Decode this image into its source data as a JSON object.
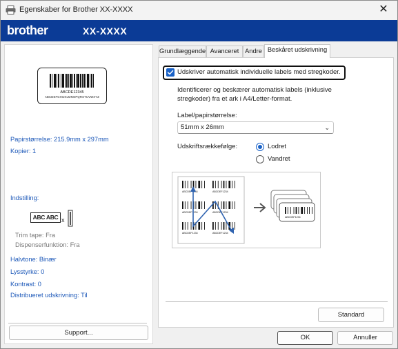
{
  "window": {
    "title": "Egenskaber for Brother XX-XXXX",
    "close_label": "✕"
  },
  "brand": {
    "logo": "brother",
    "model": "XX-XXXX",
    "bar_color": "#0b3b96"
  },
  "left": {
    "preview_text_1": "ABCDE12345",
    "preview_text_2": "ABCDEFGHIJKLMNOPQRSTUVWXYZ",
    "paper_size": "Papirstørrelse: 215.9mm x 297mm",
    "copies": "Kopier: 1",
    "setting_header": "Indstilling:",
    "setting_icon_text": "ABC ABC",
    "trim_tape": "Trim tape: Fra",
    "dispenser": "Dispenserfunktion: Fra",
    "halftone": "Halvtone: Binær",
    "brightness": "Lysstyrke:   0",
    "contrast": "Kontrast:   0",
    "distributed": "Distribueret udskrivning: Til",
    "support_button": "Support..."
  },
  "tabs": [
    {
      "label": "Grundlæggende",
      "active": false
    },
    {
      "label": "Avanceret",
      "active": false
    },
    {
      "label": "Andre",
      "active": false
    },
    {
      "label": "Beskåret udskrivning",
      "active": true
    }
  ],
  "crop": {
    "checkbox_label": "Udskriver automatisk individuelle labels med stregkoder.",
    "checkbox_checked": true,
    "desc_line_1": "Identificerer og beskærer automatisk labels (inklusive",
    "desc_line_2": "stregkoder) fra et ark i A4/Letter-format.",
    "size_label": "Label/papirstørrelse:",
    "size_value": "51mm x 26mm",
    "order_label": "Udskriftsrækkefølge:",
    "order_options": [
      {
        "label": "Lodret",
        "selected": true
      },
      {
        "label": "Vandret",
        "selected": false
      }
    ],
    "illus_code": "ABCDEF1234",
    "standard_button": "Standard"
  },
  "dialog": {
    "ok": "OK",
    "cancel": "Annuller"
  },
  "colors": {
    "accent": "#1a62c7",
    "info_text": "#1b57b8"
  }
}
